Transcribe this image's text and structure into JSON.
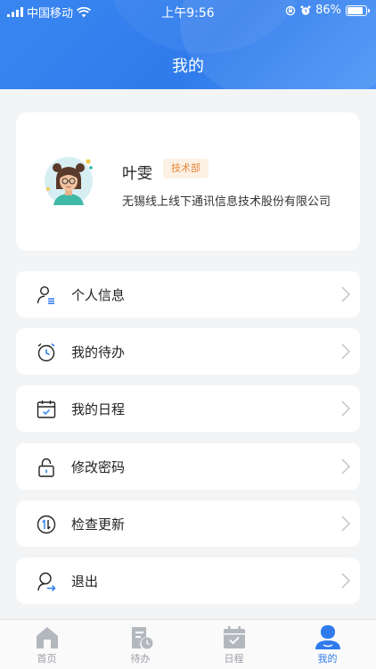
{
  "status_bar": {
    "carrier": "中国移动",
    "time": "上午9:56",
    "battery": "86%"
  },
  "header": {
    "title": "我的"
  },
  "profile": {
    "name": "叶雯",
    "department": "技术部",
    "company": "无锡线上线下通讯信息技术股份有限公司"
  },
  "menu": [
    {
      "label": "个人信息",
      "icon": "user-info-icon"
    },
    {
      "label": "我的待办",
      "icon": "alarm-clock-icon"
    },
    {
      "label": "我的日程",
      "icon": "calendar-check-icon"
    },
    {
      "label": "修改密码",
      "icon": "lock-icon"
    },
    {
      "label": "检查更新",
      "icon": "update-icon"
    },
    {
      "label": "退出",
      "icon": "logout-icon"
    }
  ],
  "tabbar": {
    "tabs": [
      {
        "label": "首页",
        "icon": "home-icon"
      },
      {
        "label": "待办",
        "icon": "todo-icon"
      },
      {
        "label": "日程",
        "icon": "schedule-icon"
      },
      {
        "label": "我的",
        "icon": "profile-icon"
      }
    ],
    "active_index": 3
  },
  "colors": {
    "primary": "#2f7bec",
    "badge_bg": "#fdf1e5",
    "badge_text": "#e7873a",
    "tab_inactive": "#9a9ea6"
  }
}
